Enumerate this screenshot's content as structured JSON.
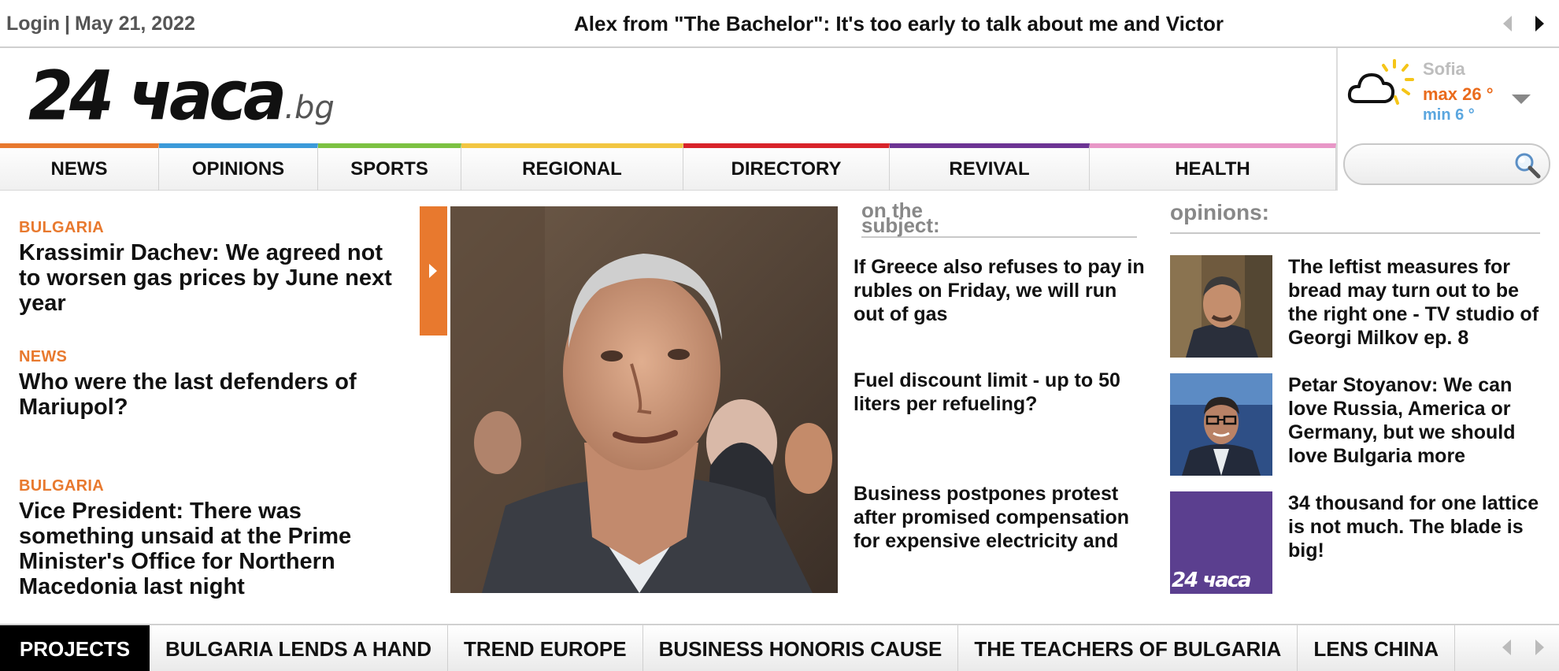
{
  "topbar": {
    "login": "Login",
    "separator": "|",
    "date": "May 21, 2022",
    "ticker": "Alex from \"The Bachelor\": It's too early to talk about me and Victor"
  },
  "logo": {
    "main": "24 часа",
    "tld": ".bg"
  },
  "weather": {
    "city": "Sofia",
    "max": "max 26 °",
    "min": "min 6 °",
    "icon": "partly-cloudy-icon",
    "colors": {
      "max": "#ea6b1c",
      "min": "#5aa6df",
      "sun": "#f5c518"
    }
  },
  "search": {
    "placeholder": "",
    "icon": "search-icon"
  },
  "nav": [
    {
      "label": "NEWS",
      "color": "#e8792e"
    },
    {
      "label": "OPINIONS",
      "color": "#3b9ad9"
    },
    {
      "label": "SPORTS",
      "color": "#7cc142"
    },
    {
      "label": "REGIONAL",
      "color": "#f2c642"
    },
    {
      "label": "DIRECTORY",
      "color": "#d8232a"
    },
    {
      "label": "REVIVAL",
      "color": "#6d3494"
    },
    {
      "label": "HEALTH",
      "color": "#e897c7"
    }
  ],
  "stories": [
    {
      "category": "BULGARIA",
      "headline": "Krassimir Dachev: We agreed not to worsen gas prices by June next year"
    },
    {
      "category": "NEWS",
      "headline": "Who were the last defenders of Mariupol?"
    },
    {
      "category": "BULGARIA",
      "headline": "Vice President: There was something unsaid at the Prime Minister's Office for Northern Macedonia last night"
    }
  ],
  "subject": {
    "title_line1": "on the",
    "title_line2": "subject:",
    "items": [
      "If Greece also refuses to pay in rubles on Friday, we will run out of gas",
      "Fuel discount limit - up to 50 liters per refueling?",
      "Business postpones protest after promised compensation for expensive electricity and"
    ]
  },
  "opinions": {
    "title": "opinions:",
    "items": [
      {
        "text": "The leftist measures for bread may turn out to be the right one - TV studio of Georgi Milkov ep. 8"
      },
      {
        "text": "Petar Stoyanov: We can love Russia, America or Germany, but we should love Bulgaria more"
      },
      {
        "text": "34 thousand for one lattice is not much. The blade is big!",
        "thumb_text": "24 часа",
        "thumb_color": "#5b3f8f"
      }
    ]
  },
  "projects": {
    "label": "PROJECTS",
    "items": [
      "BULGARIA LENDS A HAND",
      "TREND EUROPE",
      "BUSINESS HONORIS CAUSE",
      "THE TEACHERS OF BULGARIA",
      "LENS CHINA"
    ]
  }
}
